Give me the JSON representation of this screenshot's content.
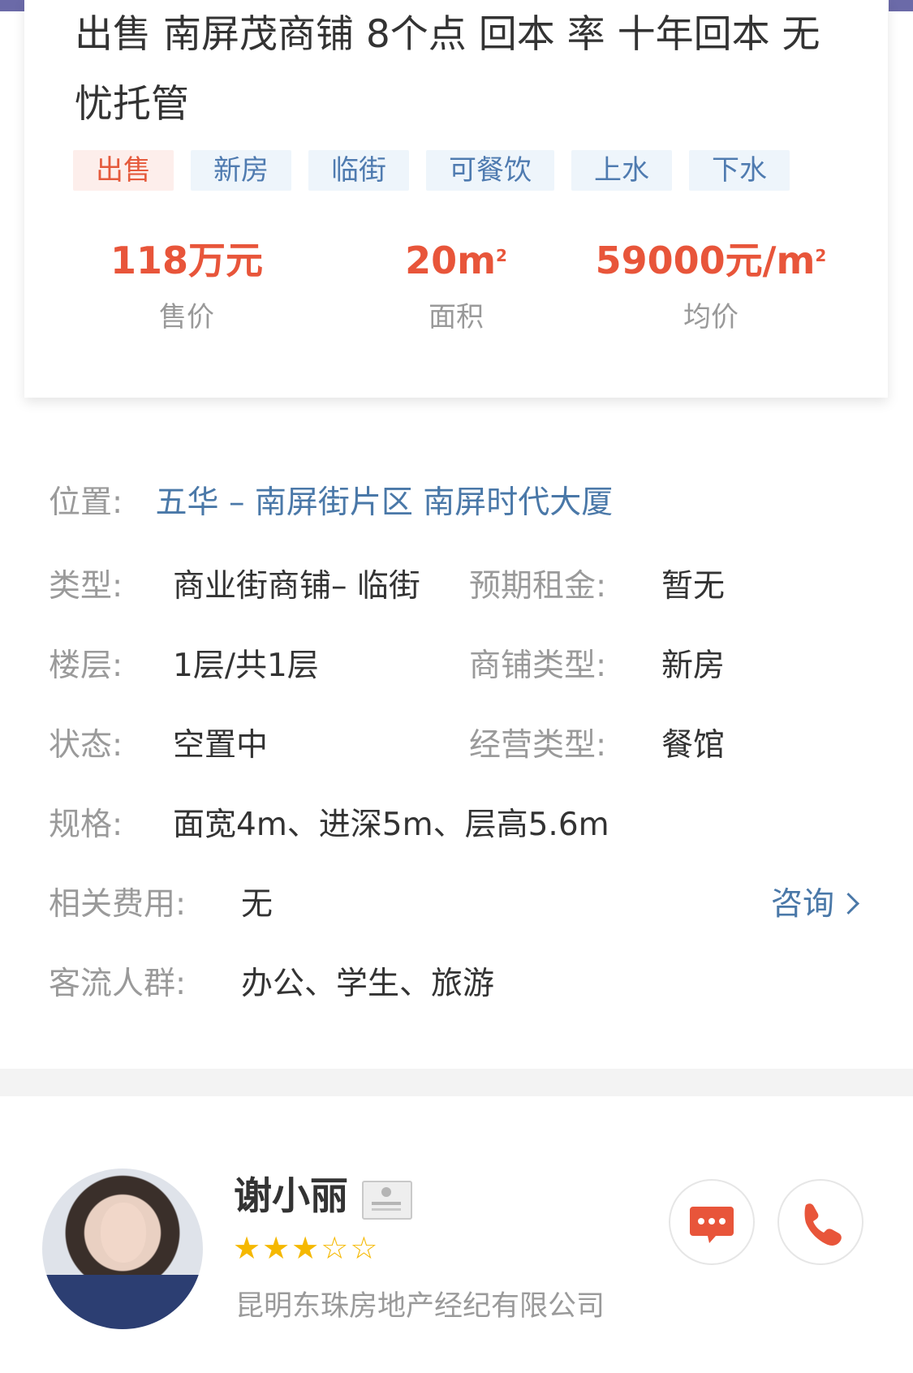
{
  "listing": {
    "title": "出售 南屏茂商铺 8个点 回本 率 十年回本 无忧托管",
    "tags": [
      {
        "label": "出售",
        "type": "sale"
      },
      {
        "label": "新房",
        "type": "normal"
      },
      {
        "label": "临街",
        "type": "normal"
      },
      {
        "label": "可餐饮",
        "type": "normal"
      },
      {
        "label": "上水",
        "type": "normal"
      },
      {
        "label": "下水",
        "type": "normal"
      }
    ],
    "stats": {
      "price": {
        "value": "118万元",
        "label": "售价"
      },
      "area": {
        "value": "20m",
        "unit_sup": "2",
        "label": "面积"
      },
      "unit_price": {
        "value": "59000元/m",
        "unit_sup": "2",
        "label": "均价"
      }
    }
  },
  "details": {
    "location_label": "位置:",
    "location_value": "五华 – 南屏街片区 南屏时代大厦",
    "type_label": "类型:",
    "type_value": "商业街商铺– 临街",
    "rent_label": "预期租金:",
    "rent_value": "暂无",
    "floor_label": "楼层:",
    "floor_value": "1层/共1层",
    "shop_type_label": "商铺类型:",
    "shop_type_value": "新房",
    "status_label": "状态:",
    "status_value": "空置中",
    "business_label": "经营类型:",
    "business_value": "餐馆",
    "spec_label": "规格:",
    "spec_value": "面宽4m、进深5m、层高5.6m",
    "fees_label": "相关费用:",
    "fees_value": "无",
    "consult_label": "咨询",
    "crowd_label": "客流人群:",
    "crowd_value": "办公、学生、旅游"
  },
  "agent": {
    "name": "谢小丽",
    "rating": 3,
    "rating_max": 5,
    "company": "昆明东珠房地产经纪有限公司"
  },
  "colors": {
    "accent_red": "#e8553a",
    "link_blue": "#4a78a8",
    "star_gold": "#f5b800"
  }
}
